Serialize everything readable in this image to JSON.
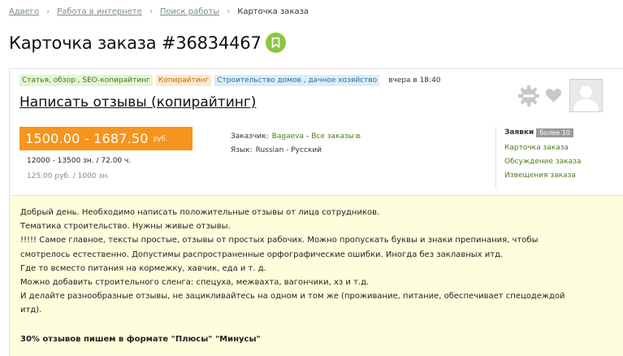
{
  "breadcrumb": {
    "items": [
      "Адвего",
      "Работа в интернете",
      "Поиск работы"
    ],
    "current": "Карточка заказа"
  },
  "title": "Карточка заказа #36834467",
  "tags": [
    {
      "label": "Статья, обзор , SEO-копирайтинг"
    },
    {
      "label": "Копирайтинг"
    },
    {
      "label": "Строительство домов , дачное хозяйство"
    }
  ],
  "posted_time": "вчера в 18:40",
  "order_name": "Написать отзывы (копирайтинг)",
  "price": {
    "range": "1500.00 - 1687.50",
    "currency": "руб.",
    "chars_line": "12000 - 13500 зн.  / 72.00 ч.",
    "rate_line": "125.00 руб.  / 1000 зн."
  },
  "customer": {
    "label": "Заказчик:",
    "name": "Bagaeva",
    "sep": "-",
    "all_orders": "Все заказы",
    "ext_icon": "external-link-icon"
  },
  "language": {
    "label": "Язык:",
    "value": "Russian - Русский"
  },
  "side": {
    "applications_label": "Заявки",
    "applications_count": "более 10",
    "links": [
      "Карточка заказа",
      "Обсуждение заказа",
      "Извещения заказа"
    ]
  },
  "icons": {
    "bookmark": "bookmark-icon",
    "gear": "gear-icon",
    "heart": "heart-icon",
    "avatar": "user-avatar-placeholder"
  },
  "colors": {
    "accent": "#8cc63f",
    "price": "#f5951e",
    "link": "#4d7c17",
    "description_bg": "#fefedd"
  },
  "description": {
    "lines": [
      "Добрый день. Необходимо написать положительные отзывы от лица сотрудников.",
      "Тематика строительство. Нужны живые отзывы.",
      "!!!!! Самое главное, тексты простые, отзывы от простых рабочих. Можно пропускать буквы и знаки препинания, чтобы",
      "смотрелось естественно. Допустимы распространенные орфографические ошибки. Иногда без заклавных итд.",
      "Где то всместо питания на кормежку, хавчик, еда и т. д.",
      "Можно добавить строительного сленга: спецуха, межвахта, вагончики, хз и т.д.",
      "И делайте разнообразные отзывы, не зацикливайтесь на одном и том же (проживание, питание, обеспечивает спецодеждой",
      "итд)."
    ],
    "bold_line": "30% отзывов пишем в формате \"Плюсы\" \"Минусы\""
  }
}
